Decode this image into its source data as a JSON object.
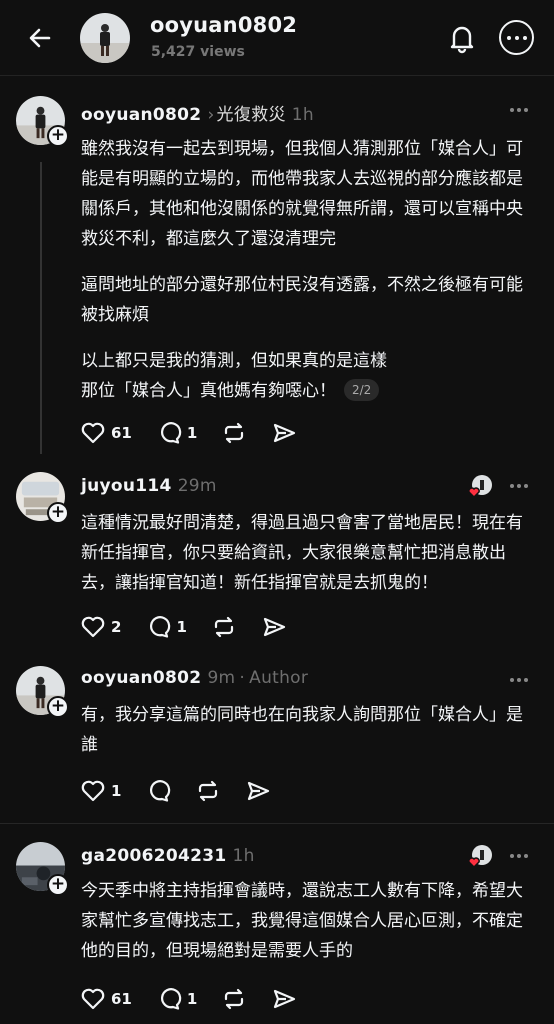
{
  "header": {
    "title": "ooyuan0802",
    "views": "5,427 views",
    "icons": [
      "back-arrow-icon",
      "bell-icon",
      "more-icon"
    ]
  },
  "posts": [
    {
      "username": "ooyuan0802",
      "topic": "光復救災",
      "time": "1h",
      "paragraphs": [
        "雖然我沒有一起去到現場，但我個人猜測那位「媒合人」可能是有明顯的立場的，而他帶我家人去巡視的部分應該都是關係戶，其他和他沒關係的就覺得無所謂，還可以宣稱中央救災不利，都這麼久了還沒清理完",
        "逼問地址的部分還好那位村民沒有透露，不然之後極有可能被找麻煩",
        "以上都只是我的猜測，但如果真的是這樣\n那位「媒合人」真他媽有夠噁心！"
      ],
      "pager": "2/2",
      "likes": "61",
      "replies": "1"
    },
    {
      "username": "juyou114",
      "time": "29m",
      "text": "這種情況最好問清楚，得過且過只會害了當地居民！現在有新任指揮官，你只要給資訊，大家很樂意幫忙把消息散出去，讓指揮官知道！新任指揮官就是去抓鬼的！",
      "likes": "2",
      "replies": "1"
    },
    {
      "username": "ooyuan0802",
      "time": "9m",
      "author_label": "Author",
      "text": "有，我分享這篇的同時也在向我家人詢問那位「媒合人」是誰",
      "likes": "1"
    },
    {
      "username": "ga2006204231",
      "time": "1h",
      "text": "今天季中將主持指揮會議時，還說志工人數有下降，希望大家幫忙多宣傳找志工，我覺得這個媒合人居心叵測，不確定他的目的，但現場絕對是需要人手的",
      "likes": "61",
      "replies": "1"
    }
  ],
  "colors": {
    "background": "#101010",
    "text": "#f3f5f7",
    "muted": "#6e6e6e",
    "heart_red": "#ff3040"
  }
}
